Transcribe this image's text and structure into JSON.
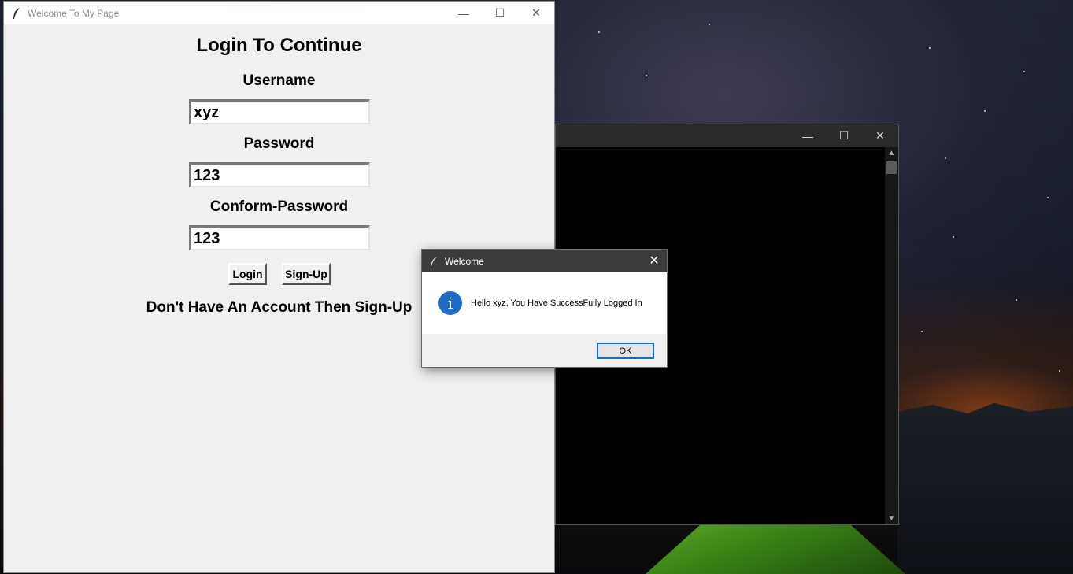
{
  "main_window": {
    "title": "Welcome To My Page",
    "controls": {
      "minimize": "—",
      "maximize": "☐",
      "close": "✕"
    }
  },
  "form": {
    "heading": "Login To Continue",
    "username_label": "Username",
    "username_value": "xyz",
    "password_label": "Password",
    "password_value": "123",
    "confirm_label": "Conform-Password",
    "confirm_value": "123",
    "login_button": "Login",
    "signup_button": "Sign-Up",
    "footer_text": "Don't Have An Account Then Sign-Up"
  },
  "console_window": {
    "controls": {
      "minimize": "—",
      "maximize": "☐",
      "close": "✕"
    }
  },
  "dialog": {
    "title": "Welcome",
    "message": "Hello xyz, You Have SuccessFully Logged In",
    "ok_button": "OK",
    "close": "✕",
    "icon": "info-icon"
  }
}
